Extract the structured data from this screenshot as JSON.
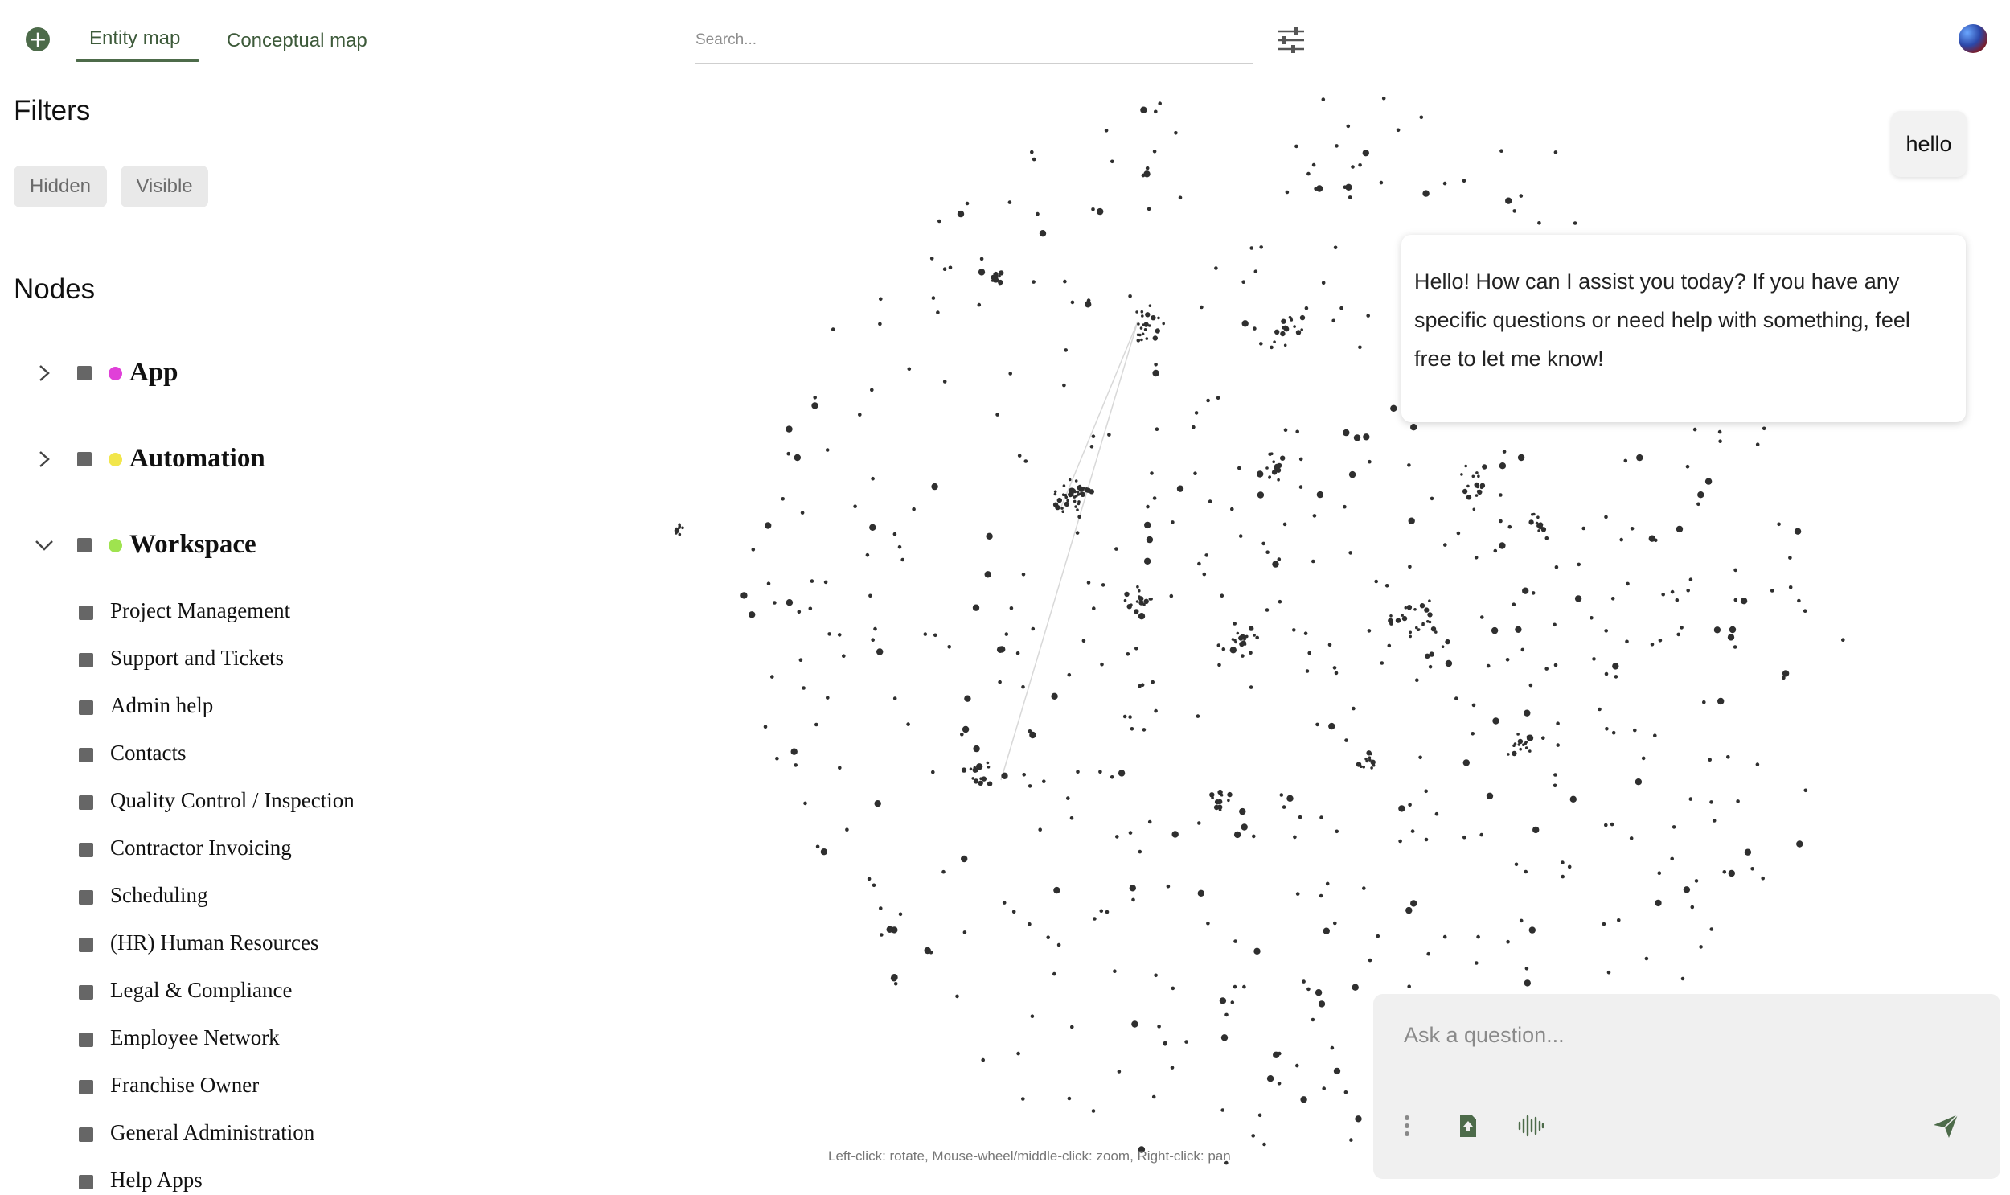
{
  "header": {
    "tabs": [
      {
        "label": "Entity map",
        "active": true
      },
      {
        "label": "Conceptual map",
        "active": false
      }
    ],
    "search": {
      "placeholder": "Search..."
    },
    "icons": [
      "add-icon",
      "filter-sliders-icon",
      "user-avatar-icon"
    ]
  },
  "sidebar": {
    "filters_title": "Filters",
    "filter_pills": [
      "Hidden",
      "Visible"
    ],
    "nodes_title": "Nodes",
    "groups": [
      {
        "label": "App",
        "color": "#e040d8",
        "expanded": false
      },
      {
        "label": "Automation",
        "color": "#f2e64b",
        "expanded": false
      },
      {
        "label": "Workspace",
        "color": "#9fe34f",
        "expanded": true,
        "children": [
          "Project Management",
          "Support and Tickets",
          "Admin help",
          "Contacts",
          "Quality Control / Inspection",
          "Contractor Invoicing",
          "Scheduling",
          "(HR) Human Resources",
          "Legal & Compliance",
          "Employee Network",
          "Franchise Owner",
          "General Administration",
          "Help Apps"
        ]
      }
    ]
  },
  "graph": {
    "hint": "Left-click: rotate, Mouse-wheel/middle-click: zoom, Right-click: pan"
  },
  "chat": {
    "user_message": "hello",
    "assistant_message": "Hello! How can I assist you today? If you have any specific questions or need help with something, feel free to let me know!",
    "input_placeholder": "Ask a question...",
    "icons": [
      "more-vertical-icon",
      "upload-icon",
      "voice-waveform-icon",
      "send-icon"
    ]
  },
  "colors": {
    "accent": "#4d6b4a",
    "chip_bg": "#e9e9e9"
  }
}
